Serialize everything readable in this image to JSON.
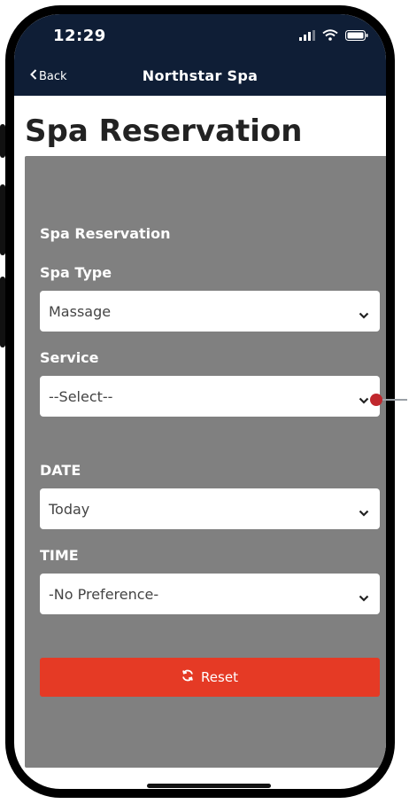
{
  "status_bar": {
    "time": "12:29"
  },
  "nav": {
    "back_label": "Back",
    "title": "Northstar Spa"
  },
  "page_title": "Spa Reservation",
  "form": {
    "section_title": "Spa Reservation",
    "spa_type": {
      "label": "Spa Type",
      "value": "Massage"
    },
    "service": {
      "label": "Service",
      "value": "--Select--"
    },
    "date": {
      "label": "DATE",
      "value": "Today"
    },
    "time": {
      "label": "TIME",
      "value": "-No Preference-"
    },
    "reset_label": "Reset"
  },
  "colors": {
    "nav_bg": "#0f1e36",
    "panel_bg": "#808080",
    "reset_bg": "#e53a25",
    "annotation_dot": "#c0272d"
  },
  "icons": [
    "signal-icon",
    "wifi-icon",
    "battery-icon",
    "back-chevron-icon",
    "chevron-down-icon",
    "refresh-icon"
  ]
}
